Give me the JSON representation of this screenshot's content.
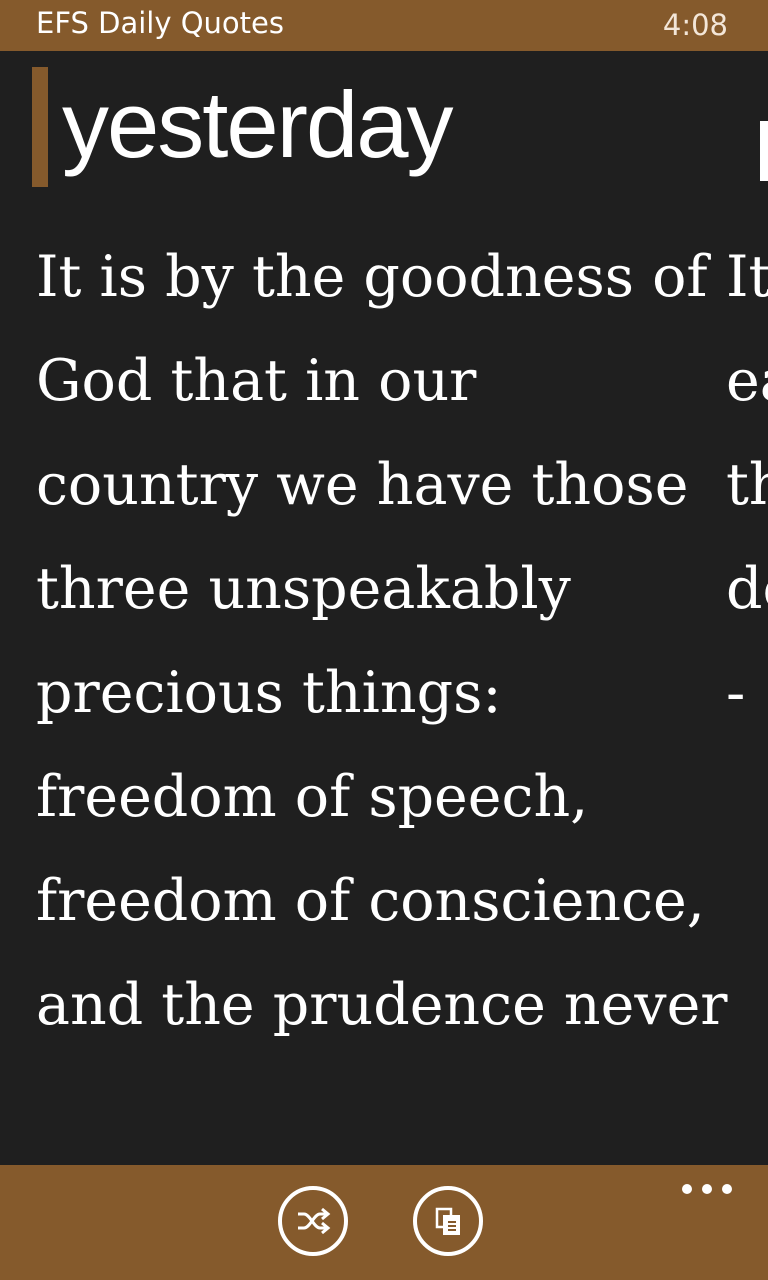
{
  "status_bar": {
    "app_name": "EFS Daily Quotes",
    "time": "4:08"
  },
  "pivot": {
    "current_title": "yesterday"
  },
  "quote": {
    "lines": [
      "It is by the goodness of",
      "God that in our",
      "country we have those",
      "three unspeakably",
      "precious things:",
      "freedom of speech,",
      "freedom of conscience,",
      "and the prudence never"
    ]
  },
  "next_quote_peek": {
    "lines": [
      "It",
      "ea",
      "th",
      "de",
      "-"
    ]
  },
  "app_bar": {
    "buttons": [
      {
        "icon": "shuffle-icon"
      },
      {
        "icon": "copy-icon"
      }
    ],
    "more_label": "..."
  },
  "colors": {
    "accent": "#855a2c",
    "background": "#1f1f1f",
    "text": "#ffffff"
  }
}
